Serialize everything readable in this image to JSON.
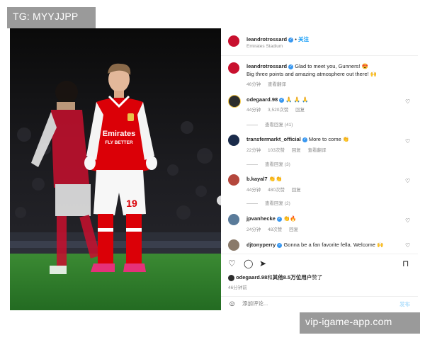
{
  "watermarks": {
    "top_left": "TG: MYYJJPP",
    "bottom_right": "vip-igame-app.com"
  },
  "post": {
    "author": "leandrotrossard",
    "follow_label": "关注",
    "location": "Emirates Stadium",
    "caption_line1": "Glad to meet you, Gunners! 😍",
    "caption_line2": "Big three points and amazing atmosphere out there! 🙌",
    "caption_time": "46分钟",
    "caption_translate": "查看翻译",
    "photo_icons": {
      "next": "chevron-right-icon",
      "tag": "user-tag-icon"
    },
    "jersey": {
      "sponsor_line1": "Emirates",
      "sponsor_line2": "FLY BETTER",
      "number": "19"
    }
  },
  "comments": [
    {
      "user": "odegaard.98",
      "text": "🙏 🙏 🙏",
      "time": "44分钟",
      "likes": "3,520次赞",
      "reply": "回复",
      "replies_label": "查看回复 (41)"
    },
    {
      "user": "transfermarkt_official",
      "text": "More to come 👏",
      "time": "22分钟",
      "likes": "103次赞",
      "reply": "回复",
      "translate": "查看翻译",
      "replies_label": "查看回复 (3)"
    },
    {
      "user": "b.kayal7",
      "text": "👏👏",
      "time": "44分钟",
      "likes": "480次赞",
      "reply": "回复",
      "replies_label": "查看回复 (2)"
    },
    {
      "user": "jpvanhecke",
      "text": "👏🔥",
      "time": "24分钟",
      "likes": "48次赞",
      "reply": "回复"
    },
    {
      "user": "djtonyperry",
      "text": "Gonna be a fan favorite fella. Welcome 🙌"
    }
  ],
  "likes_summary": {
    "user": "odegaard.98",
    "middle": "和",
    "others": "其他8.5万位用户",
    "end": "赞了",
    "time": "46分钟前"
  },
  "add_comment": {
    "placeholder": "添加评论...",
    "post_label": "发布"
  },
  "icons": [
    "heart-icon",
    "comment-icon",
    "share-icon",
    "bookmark-icon",
    "emoji-icon"
  ],
  "colors": {
    "accent": "#0095f6",
    "arsenal_red": "#db0007",
    "pitch": "#2f7a2a"
  }
}
